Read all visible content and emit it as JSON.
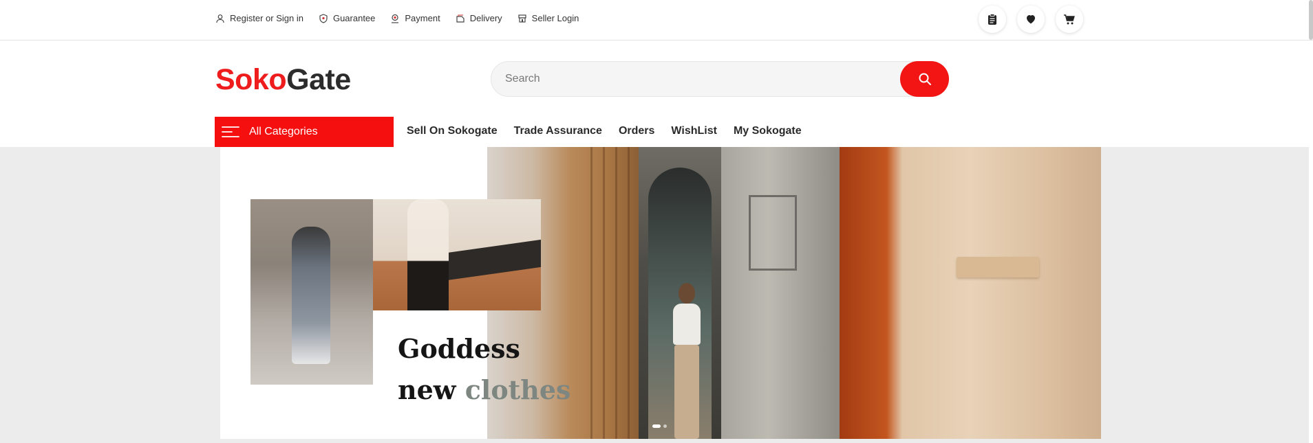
{
  "topbar": {
    "links": [
      {
        "label": "Register or Sign in",
        "icon": "user-icon"
      },
      {
        "label": "Guarantee",
        "icon": "shield-icon"
      },
      {
        "label": "Payment",
        "icon": "payment-icon"
      },
      {
        "label": "Delivery",
        "icon": "delivery-icon"
      },
      {
        "label": "Seller Login",
        "icon": "store-icon"
      }
    ],
    "icons": [
      "clipboard-icon",
      "heart-icon",
      "cart-icon"
    ]
  },
  "header": {
    "logo_part1": "Soko",
    "logo_part2": "Gate",
    "search_placeholder": "Search"
  },
  "nav": {
    "all_categories": "All Categories",
    "links": [
      "Sell On Sokogate",
      "Trade Assurance",
      "Orders",
      "WishList",
      "My Sokogate"
    ]
  },
  "banner": {
    "line1": "Goddess",
    "line2_a": "new",
    "line2_b": "clothes",
    "slide_count": 2,
    "active_slide": 1
  },
  "colors": {
    "brand_red": "#f31414",
    "logo_dark": "#2c2c2c",
    "hero_bg": "#ececec"
  }
}
